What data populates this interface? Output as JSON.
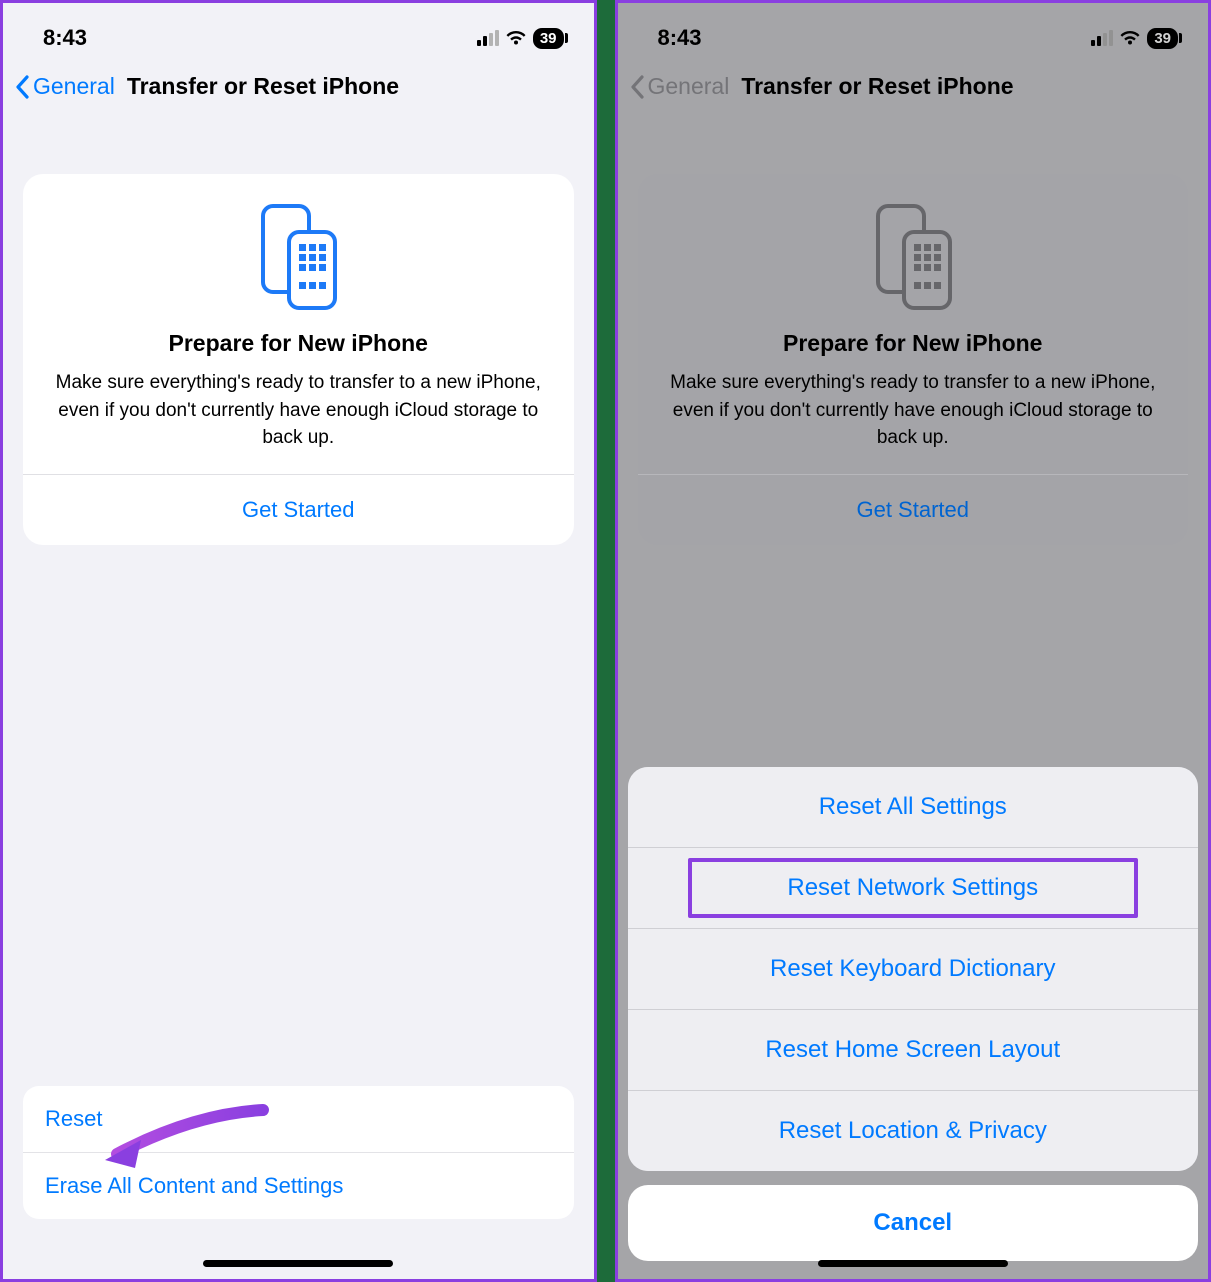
{
  "status": {
    "time": "8:43",
    "battery_pct": "39"
  },
  "nav": {
    "back_label": "General",
    "title": "Transfer or Reset iPhone"
  },
  "card": {
    "heading": "Prepare for New iPhone",
    "body": "Make sure everything's ready to transfer to a new iPhone, even if you don't currently have enough iCloud storage to back up.",
    "cta": "Get Started"
  },
  "bottom_options": {
    "reset": "Reset",
    "erase": "Erase All Content and Settings"
  },
  "action_sheet": {
    "options": [
      "Reset All Settings",
      "Reset Network Settings",
      "Reset Keyboard Dictionary",
      "Reset Home Screen Layout",
      "Reset Location & Privacy"
    ],
    "highlight_index": 1,
    "cancel": "Cancel"
  },
  "colors": {
    "ios_blue": "#007aff",
    "annotation_purple": "#8a3fe0"
  }
}
